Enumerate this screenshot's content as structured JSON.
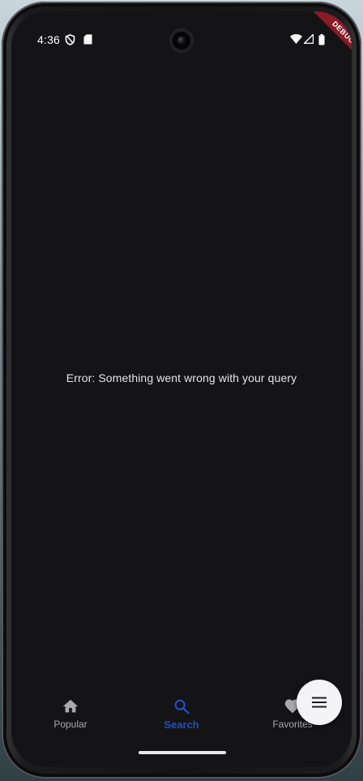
{
  "status_bar": {
    "time": "4:36",
    "icons": [
      "shield-icon",
      "sd-card-icon",
      "wifi-icon",
      "signal-icon",
      "battery-icon"
    ]
  },
  "debug_banner": {
    "label": "DEBUG",
    "color": "#8b1a26"
  },
  "main": {
    "error_message": "Error: Something went wrong with your query"
  },
  "bottom_nav": {
    "items": [
      {
        "label": "Popular",
        "icon": "home-icon",
        "active": false
      },
      {
        "label": "Search",
        "icon": "search-icon",
        "active": true
      },
      {
        "label": "Favorites",
        "icon": "heart-icon",
        "active": false
      }
    ],
    "active_color": "#1f4fc0",
    "inactive_color": "#a9a9ad"
  },
  "fab": {
    "icon": "menu-icon"
  },
  "colors": {
    "background": "#141416",
    "text": "#e4e4e6"
  }
}
